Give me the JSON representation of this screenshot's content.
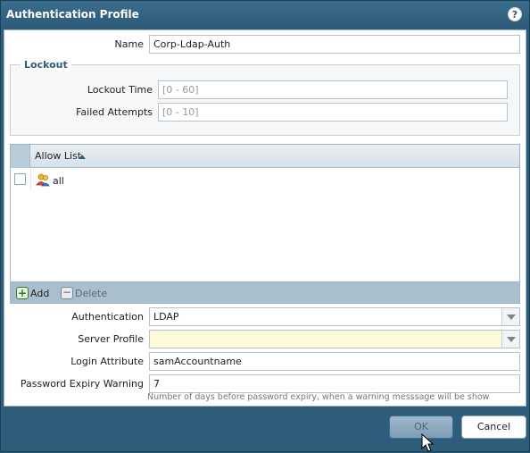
{
  "dialog": {
    "title": "Authentication Profile",
    "help_icon": "?"
  },
  "fields": {
    "name_label": "Name",
    "name_value": "Corp-Ldap-Auth",
    "lockout_legend": "Lockout",
    "lockout_time_label": "Lockout Time",
    "lockout_time_placeholder": "[0 - 60]",
    "failed_attempts_label": "Failed Attempts",
    "failed_attempts_placeholder": "[0 - 10]"
  },
  "allow_list": {
    "header": "Allow List",
    "rows": [
      {
        "text": "all",
        "icon": "user-group-icon"
      }
    ],
    "add_label": "Add",
    "delete_label": "Delete"
  },
  "auth": {
    "authentication_label": "Authentication",
    "authentication_value": "LDAP",
    "server_profile_label": "Server Profile",
    "server_profile_value": "",
    "login_attribute_label": "Login Attribute",
    "login_attribute_value": "samAccountname",
    "password_expiry_label": "Password Expiry Warning",
    "password_expiry_value": "7",
    "password_expiry_hint": "Number of days before password expiry, when a warning messsage will be show"
  },
  "buttons": {
    "ok": "OK",
    "cancel": "Cancel"
  }
}
